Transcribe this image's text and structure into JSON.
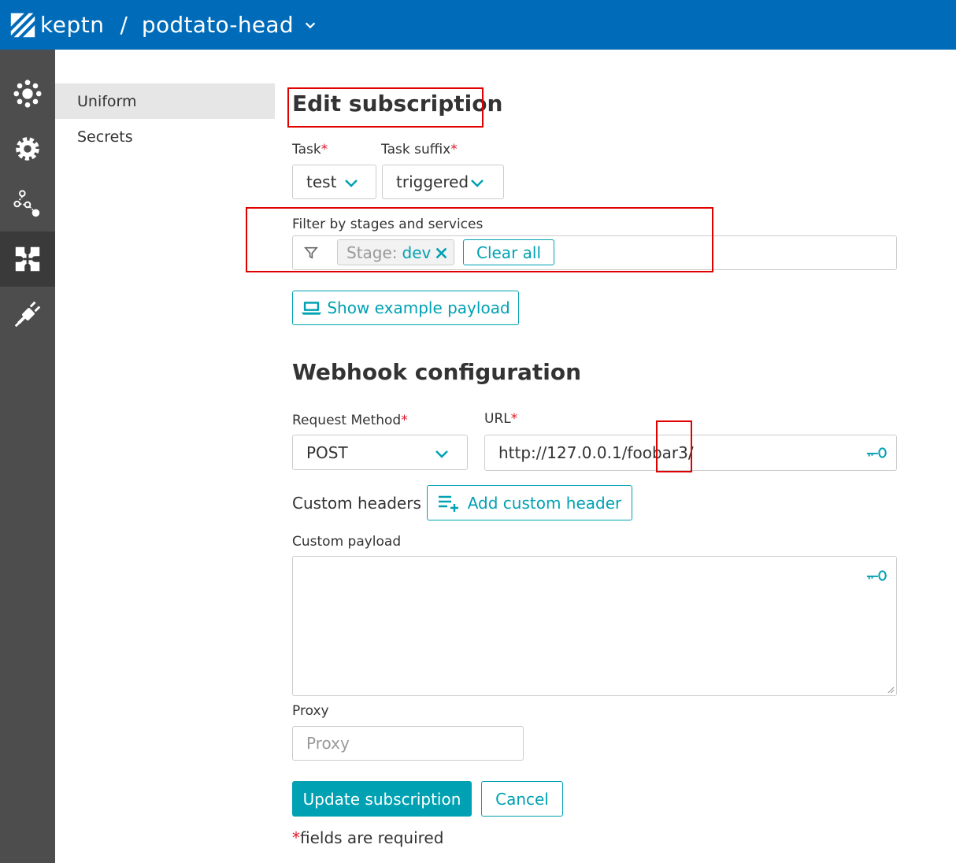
{
  "header": {
    "logo_text": "keptn",
    "separator": "/",
    "project_name": "podtato-head"
  },
  "sidenav": {
    "items": [
      {
        "icon": "environment-icon",
        "active": false
      },
      {
        "icon": "gear-icon",
        "active": false
      },
      {
        "icon": "sequence-icon",
        "active": false
      },
      {
        "icon": "integrations-icon",
        "active": true
      },
      {
        "icon": "plug-icon",
        "active": false
      }
    ]
  },
  "subnav": {
    "items": [
      {
        "label": "Uniform",
        "active": true
      },
      {
        "label": "Secrets",
        "active": false
      }
    ]
  },
  "form": {
    "title": "Edit subscription",
    "task_label": "Task",
    "task_value": "test",
    "task_suffix_label": "Task suffix",
    "task_suffix_value": "triggered",
    "required_marker": "*",
    "filter_label": "Filter by stages and services",
    "filter_chip_key": "Stage:",
    "filter_chip_value": "dev",
    "clear_all_label": "Clear all",
    "show_payload_label": "Show example payload",
    "webhook_title": "Webhook configuration",
    "method_label": "Request Method",
    "method_value": "POST",
    "url_label": "URL",
    "url_value": "http://127.0.0.1/foobar3/",
    "custom_headers_label": "Custom headers",
    "add_header_label": "Add custom header",
    "payload_label": "Custom payload",
    "payload_value": "",
    "proxy_label": "Proxy",
    "proxy_placeholder": "Proxy",
    "update_label": "Update subscription",
    "cancel_label": "Cancel",
    "required_note": "fields are required"
  },
  "colors": {
    "header_bg": "#006bb8",
    "sidenav_bg": "#4d4d4d",
    "accent": "#00a1b2",
    "required": "#dc172a",
    "annotation": "#e00000"
  }
}
